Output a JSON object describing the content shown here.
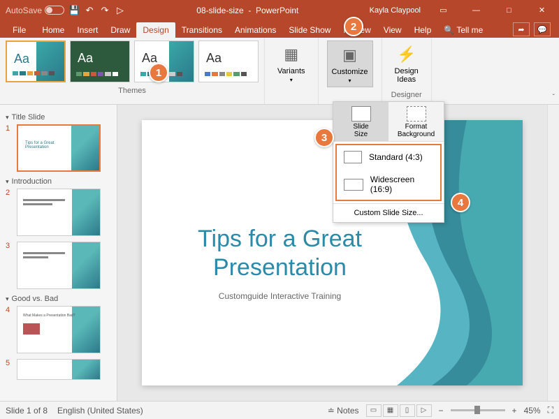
{
  "titlebar": {
    "autosave": "AutoSave",
    "doc": "08-slide-size",
    "app": "PowerPoint",
    "user": "Kayla Claypool"
  },
  "tabs": {
    "file": "File",
    "home": "Home",
    "insert": "Insert",
    "draw": "Draw",
    "design": "Design",
    "transitions": "Transitions",
    "animations": "Animations",
    "slideshow": "Slide Show",
    "review": "Review",
    "view": "View",
    "help": "Help",
    "tellme": "Tell me"
  },
  "ribbon": {
    "themes": "Themes",
    "variants_btn": "Variants",
    "customize_btn": "Customize",
    "design_ideas": "Design\nIdeas",
    "designer": "Designer"
  },
  "dropdown": {
    "slide_size": "Slide\nSize",
    "format_bg": "Format\nBackground",
    "standard": "Standard (4:3)",
    "widescreen": "Widescreen (16:9)",
    "custom": "Custom Slide Size..."
  },
  "sections": {
    "s1": "Title Slide",
    "s2": "Introduction",
    "s3": "Good vs. Bad"
  },
  "slide": {
    "title": "Tips for a Great Presentation",
    "subtitle": "Customguide Interactive Training"
  },
  "status": {
    "slide": "Slide 1 of 8",
    "lang": "English (United States)",
    "notes": "Notes",
    "zoom": "45%"
  },
  "callouts": {
    "c1": "1",
    "c2": "2",
    "c3": "3",
    "c4": "4"
  }
}
